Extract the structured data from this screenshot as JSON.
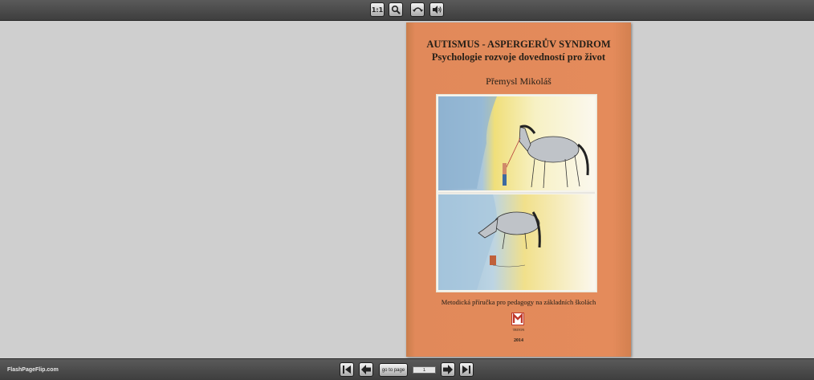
{
  "toolbar": {
    "actual_size_label": "1:1",
    "zoom_icon": "magnifier-icon",
    "flip_icon": "page-flip-icon",
    "sound_icon": "speaker-icon"
  },
  "book": {
    "title_line1": "AUTISMUS - ASPERGERŮV SYNDROM",
    "title_line2": "Psychologie rozvoje dovedností pro život",
    "author": "Přemysl Mikoláš",
    "subtitle": "Metodická příručka pro pedagogy na základních školách",
    "publisher": "TRITON",
    "year": "2014",
    "cover_color": "#e48b5b"
  },
  "footer": {
    "brand": "FlashPageFlip.com",
    "goto_label": "go to page",
    "page_value": "1"
  }
}
